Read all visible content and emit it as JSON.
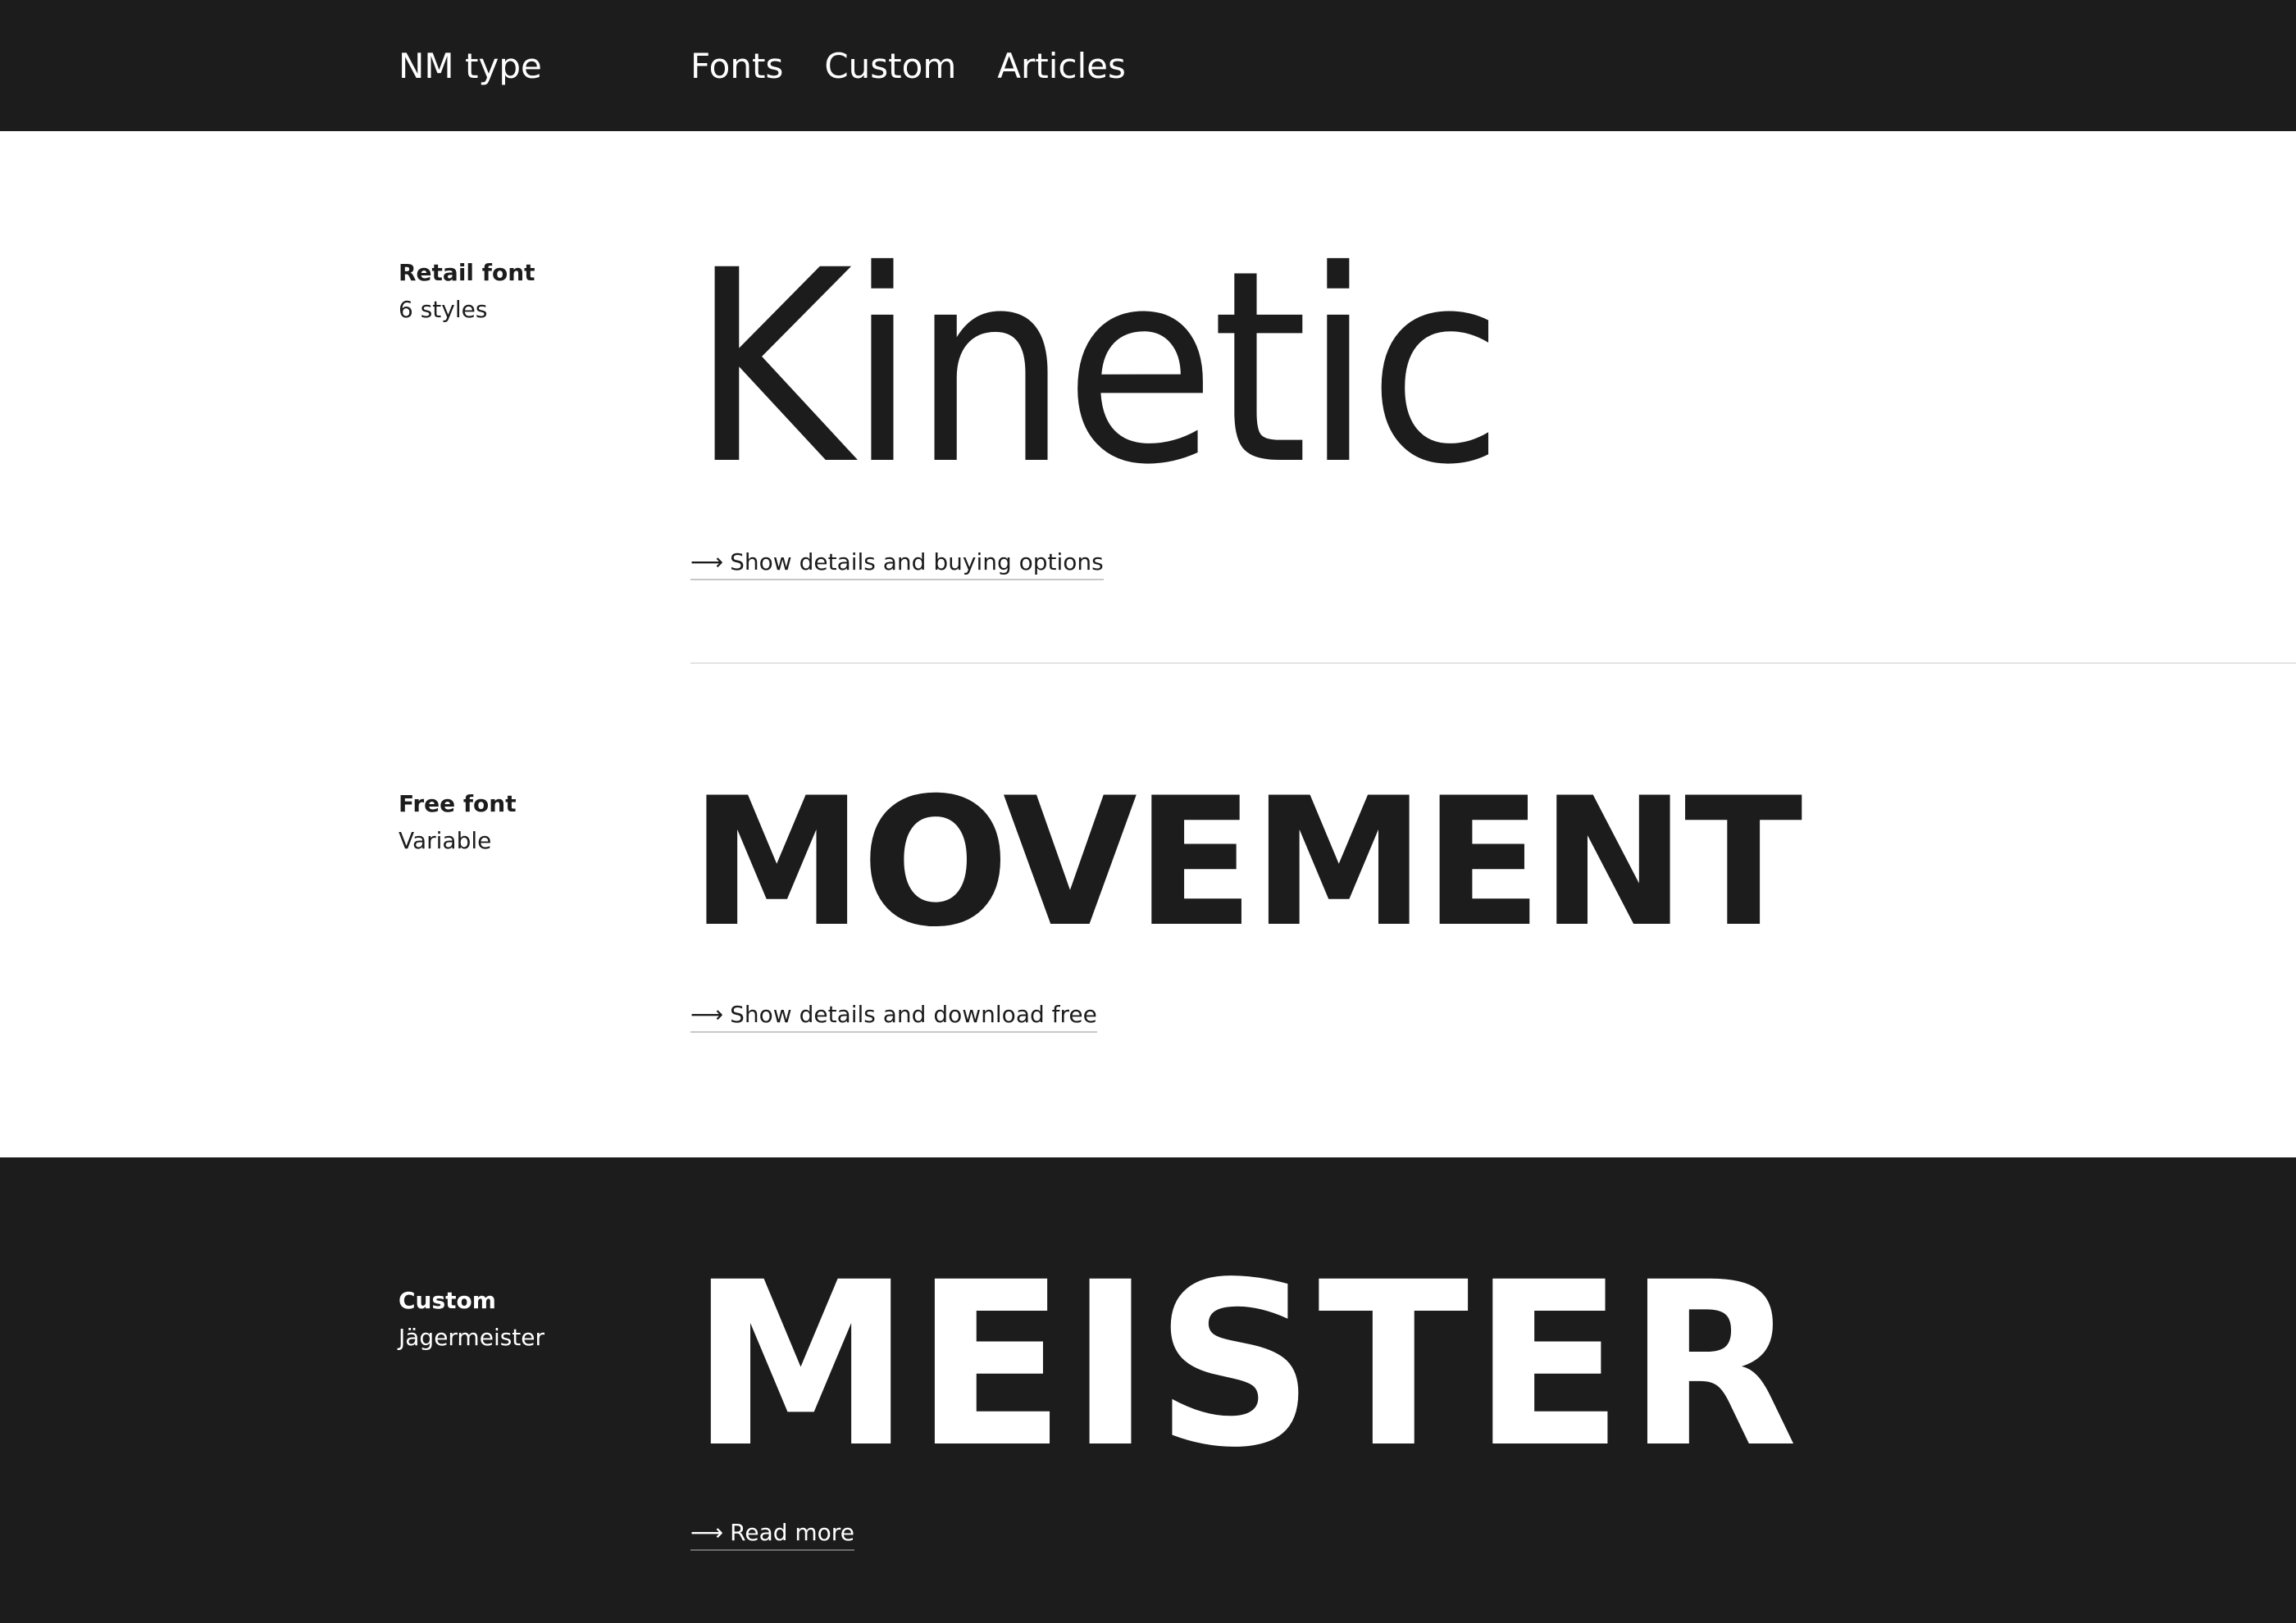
{
  "header": {
    "brand": "NM type",
    "nav": [
      {
        "label": "Fonts"
      },
      {
        "label": "Custom"
      },
      {
        "label": "Articles"
      }
    ]
  },
  "fonts": [
    {
      "kind": "Retail font",
      "sub": "6 styles",
      "specimen": "Kinetic",
      "link_label": "Show details and buying options"
    },
    {
      "kind": "Free font",
      "sub": "Variable",
      "specimen": "MOVEMENT",
      "link_label": "Show details and download free"
    }
  ],
  "custom": {
    "kind": "Custom",
    "sub": "Jägermeister",
    "specimen": "MEISTER",
    "link_label": "Read more"
  },
  "icons": {
    "arrow": "arrow-right-icon",
    "arrow_glyph": "⟶"
  },
  "colors": {
    "dark": "#1c1c1c",
    "light": "#ffffff",
    "divider": "#e3e3e3"
  }
}
